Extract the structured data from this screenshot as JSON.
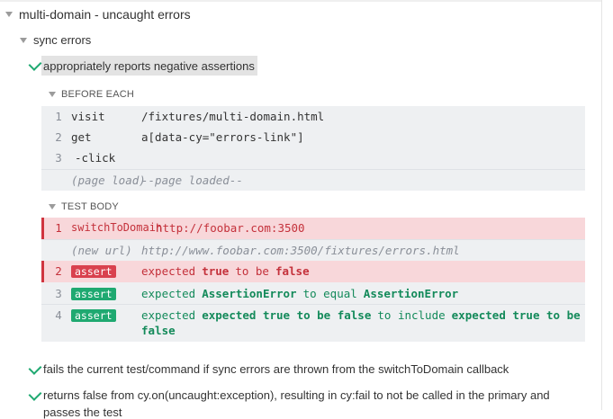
{
  "suite": {
    "title": "multi-domain - uncaught errors"
  },
  "sub_suite": {
    "title": "sync errors"
  },
  "test": {
    "title": "appropriately reports negative assertions"
  },
  "before_each": {
    "label": "BEFORE EACH",
    "rows": [
      {
        "num": "1",
        "name": "visit",
        "msg": "/fixtures/multi-domain.html"
      },
      {
        "num": "2",
        "name": "get",
        "msg": "a[data-cy=\"errors-link\"]"
      },
      {
        "num": "3",
        "name": "-click",
        "msg": ""
      },
      {
        "num": "",
        "name": "(page load)",
        "msg": "--page loaded--"
      }
    ]
  },
  "test_body": {
    "label": "TEST BODY",
    "row1": {
      "num": "1",
      "name": "switchToDomain",
      "msg": "http://foobar.com:3500"
    },
    "row_url": {
      "name": "(new url)",
      "msg": "http://www.foobar.com:3500/fixtures/errors.html"
    },
    "row2": {
      "num": "2",
      "badge": "assert",
      "p1": "expected",
      "p2": "true",
      "p3": "to be",
      "p4": "false"
    },
    "row3": {
      "num": "3",
      "badge": "assert",
      "p1": "expected",
      "p2": "AssertionError",
      "p3": "to equal",
      "p4": "AssertionError"
    },
    "row4": {
      "num": "4",
      "badge": "assert",
      "p1": "expected",
      "p2": "expected true to be false",
      "p3": "to include",
      "p4": "expected true to be",
      "p5": "false"
    }
  },
  "other_tests": [
    {
      "title": "fails the current test/command if sync errors are thrown from the switchToDomain callback"
    },
    {
      "title": "returns false from cy.on(uncaught:exception), resulting in cy:fail to not be called in the primary and",
      "title_cont": "passes the test"
    }
  ],
  "colors": {
    "pass": "#1fa971",
    "fail": "#d0343f",
    "fail_bg": "#f8d7da",
    "block_bg": "#eef0f2"
  }
}
